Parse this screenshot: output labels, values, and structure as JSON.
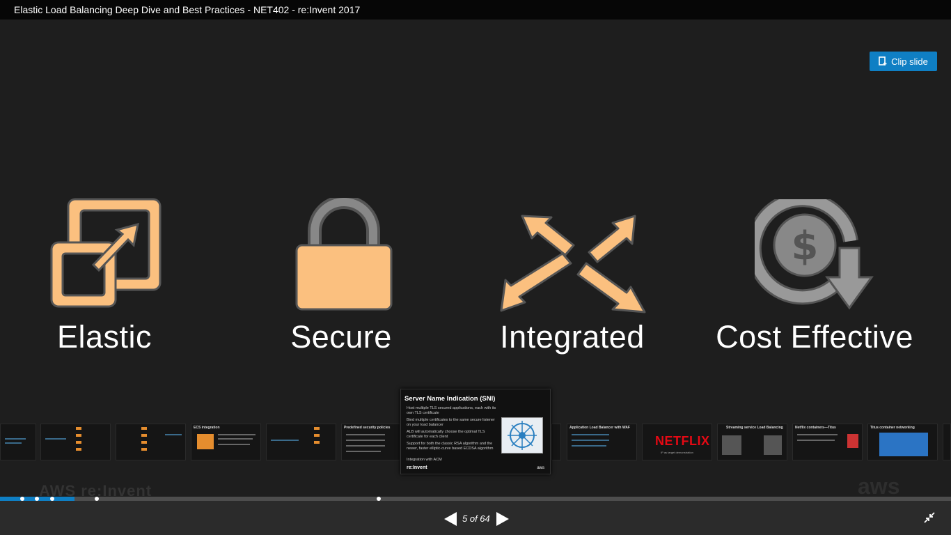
{
  "window": {
    "title": "Elastic Load Balancing Deep Dive and Best Practices - NET402 - re:Invent 2017"
  },
  "toolbar": {
    "clip_label": "Clip slide",
    "clip_icon": "clip-icon"
  },
  "slide": {
    "pillars": [
      {
        "label": "Elastic",
        "icon": "elastic-icon"
      },
      {
        "label": "Secure",
        "icon": "padlock-icon"
      },
      {
        "label": "Integrated",
        "icon": "crossed-arrows-icon"
      },
      {
        "label": "Cost Effective",
        "icon": "dollar-down-arrow-icon"
      }
    ],
    "colors": {
      "icon_fill": "#fbc07f",
      "icon_stroke": "#555555",
      "background": "#1e1e1e"
    }
  },
  "thumbnails": [
    {
      "title": ""
    },
    {
      "title": ""
    },
    {
      "title": ""
    },
    {
      "title": "ECS integration"
    },
    {
      "title": ""
    },
    {
      "title": "Predefined security policies"
    },
    {
      "title": "Application Load Balancer with WAF"
    },
    {
      "title": "NETFLIX",
      "subtitle": "IP as target demonstration"
    },
    {
      "title": "Streaming service Load Balancing"
    },
    {
      "title": "Netflix containers—Titus"
    },
    {
      "title": "Titus container networking"
    }
  ],
  "preview": {
    "title": "Server Name Indication (SNI)",
    "lines": [
      "Host multiple TLS secured applications, each with its own TLS certificate",
      "Bind multiple certificates to the same secure listener on your load balancer",
      "ALB will automatically choose the optimal TLS certificate for each client",
      "Support for both the classic RSA algorithm and the newer, faster elliptic-curve based ECDSA algorithm",
      "Integration with ACM"
    ],
    "footer": "re:Invent",
    "brand": "aws"
  },
  "watermarks": {
    "left": "AWS re:Invent",
    "right": "aws"
  },
  "progress": {
    "fraction": 0.078
  },
  "nav": {
    "counter": "5 of 64",
    "prev_icon": "prev-arrow-icon",
    "next_icon": "next-arrow-icon",
    "fullscreen_icon": "exit-fullscreen-icon"
  }
}
